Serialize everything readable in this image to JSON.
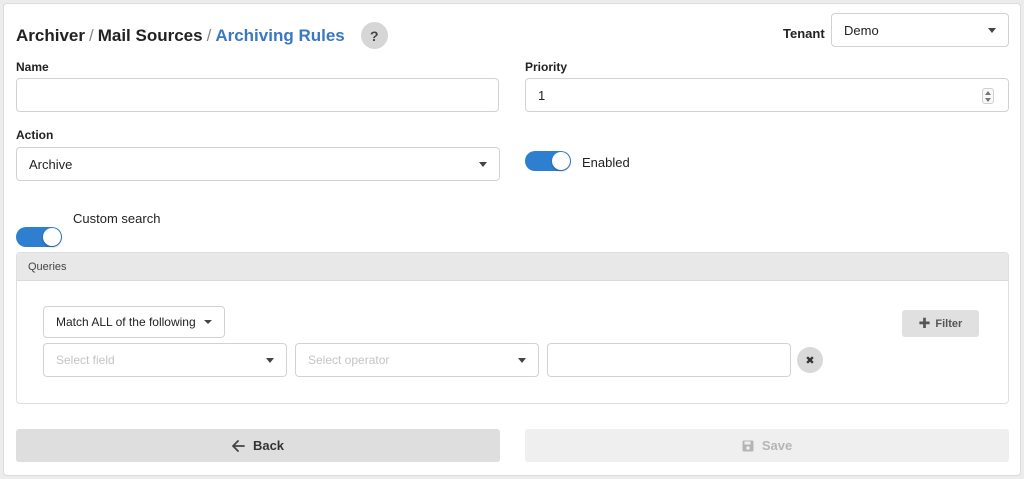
{
  "breadcrumb": {
    "items": [
      "Archiver",
      "Mail Sources",
      "Archiving Rules"
    ],
    "separator": "/",
    "help_label": "?"
  },
  "tenant": {
    "label": "Tenant",
    "value": "Demo"
  },
  "form": {
    "name_label": "Name",
    "name_value": "",
    "priority_label": "Priority",
    "priority_value": "1",
    "action_label": "Action",
    "action_value": "Archive",
    "enabled_label": "Enabled",
    "enabled_on": true,
    "custom_search_label": "Custom search",
    "custom_search_on": true
  },
  "queries": {
    "title": "Queries",
    "match_label": "Match ALL of the following",
    "field_placeholder": "Select field",
    "operator_placeholder": "Select operator",
    "value": "",
    "filter_label": "Filter",
    "remove_icon": "✖"
  },
  "actions": {
    "back_label": "Back",
    "save_label": "Save"
  },
  "colors": {
    "accent": "#3a78c3",
    "toggle": "#2f7fd0"
  },
  "icons": {
    "filter": "plus-icon",
    "back": "arrow-left-icon",
    "save": "floppy-disk-icon",
    "remove": "close-icon"
  }
}
